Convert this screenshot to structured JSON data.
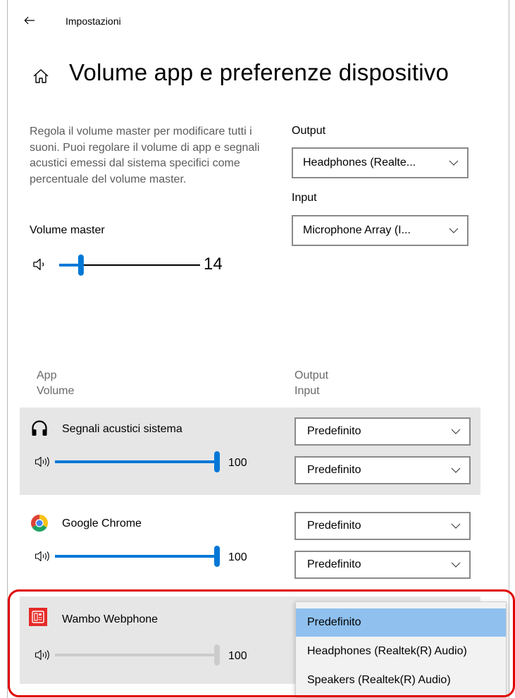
{
  "window": {
    "title": "Impostazioni"
  },
  "page": {
    "title": "Volume app e preferenze dispositivo"
  },
  "master": {
    "description": "Regola il volume master per modificare tutti i suoni. Puoi regolare il volume di app e segnali acustici emessi dal sistema specifici come percentuale del volume master.",
    "label": "Volume master",
    "value": "14",
    "level": 0.14,
    "icon": "speaker-low-icon"
  },
  "devices": {
    "output_label": "Output",
    "output_value": "Headphones (Realte...",
    "input_label": "Input",
    "input_value": "Microphone Array (I..."
  },
  "columns": {
    "app": "App",
    "volume": "Volume",
    "output": "Output",
    "input": "Input"
  },
  "apps": [
    {
      "name": "Segnali acustici sistema",
      "icon": "headphones-icon",
      "volume": "100",
      "level": 1.0,
      "output": "Predefinito",
      "input": "Predefinito"
    },
    {
      "name": "Google Chrome",
      "icon": "chrome-icon",
      "volume": "100",
      "level": 1.0,
      "output": "Predefinito",
      "input": "Predefinito"
    },
    {
      "name": "Wambo Webphone",
      "icon": "webphone-icon",
      "volume": "100",
      "level": 1.0,
      "disabled": true
    }
  ],
  "output_menu": {
    "options": [
      "Predefinito",
      "Headphones (Realtek(R) Audio)",
      "Speakers (Realtek(R) Audio)"
    ],
    "selected": "Predefinito"
  },
  "colors": {
    "accent": "#0078d7",
    "row_background": "#e6e6e6",
    "menu_selected": "#8fc0ee",
    "highlight": "#e00000",
    "disabled_slider": "#cccccc"
  }
}
